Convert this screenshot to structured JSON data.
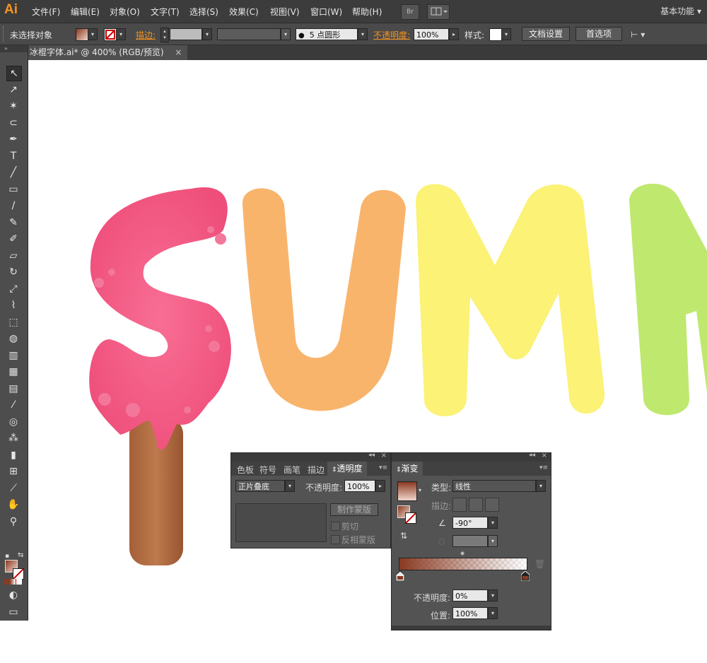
{
  "app": {
    "logo": "Ai",
    "workspace": "基本功能"
  },
  "menu": [
    "文件(F)",
    "编辑(E)",
    "对象(O)",
    "文字(T)",
    "选择(S)",
    "效果(C)",
    "视图(V)",
    "窗口(W)",
    "帮助(H)"
  ],
  "menubar_buttons": {
    "bridge": "Br"
  },
  "control": {
    "no_selection": "未选择对象",
    "stroke_label": "描边:",
    "brush": "5 点圆形",
    "opacity_label": "不透明度:",
    "opacity_value": "100%",
    "style_label": "样式:",
    "doc_setup": "文档设置",
    "preferences": "首选项"
  },
  "document": {
    "tab_title": "冰棍字体.ai* @ 400% (RGB/预览)",
    "close": "×"
  },
  "toolbar": {
    "tools": [
      {
        "name": "selection-tool",
        "glyph": "↖"
      },
      {
        "name": "direct-selection-tool",
        "glyph": "↗"
      },
      {
        "name": "magic-wand-tool",
        "glyph": "✶"
      },
      {
        "name": "lasso-tool",
        "glyph": "⊂"
      },
      {
        "name": "pen-tool",
        "glyph": "✒"
      },
      {
        "name": "type-tool",
        "glyph": "T"
      },
      {
        "name": "line-tool",
        "glyph": "╱"
      },
      {
        "name": "rectangle-tool",
        "glyph": "▭"
      },
      {
        "name": "paintbrush-tool",
        "glyph": "∕"
      },
      {
        "name": "pencil-tool",
        "glyph": "✎"
      },
      {
        "name": "blob-brush-tool",
        "glyph": "✐"
      },
      {
        "name": "eraser-tool",
        "glyph": "▱"
      },
      {
        "name": "rotate-tool",
        "glyph": "↻"
      },
      {
        "name": "scale-tool",
        "glyph": "⤢"
      },
      {
        "name": "warp-tool",
        "glyph": "⌇"
      },
      {
        "name": "free-transform-tool",
        "glyph": "⬚"
      },
      {
        "name": "shape-builder-tool",
        "glyph": "◍"
      },
      {
        "name": "perspective-grid-tool",
        "glyph": "▥"
      },
      {
        "name": "mesh-tool",
        "glyph": "▦"
      },
      {
        "name": "gradient-tool",
        "glyph": "▤"
      },
      {
        "name": "eyedropper-tool",
        "glyph": "⁄"
      },
      {
        "name": "blend-tool",
        "glyph": "◎"
      },
      {
        "name": "symbol-sprayer-tool",
        "glyph": "⁂"
      },
      {
        "name": "column-graph-tool",
        "glyph": "▮"
      },
      {
        "name": "artboard-tool",
        "glyph": "⊞"
      },
      {
        "name": "slice-tool",
        "glyph": "⟋"
      },
      {
        "name": "hand-tool",
        "glyph": "✋"
      },
      {
        "name": "zoom-tool",
        "glyph": "⚲"
      }
    ]
  },
  "artwork": {
    "letters": [
      "S",
      "U",
      "M",
      "M"
    ],
    "colors": [
      "#f25a84",
      "#f9b46c",
      "#fbf276",
      "#bfe86f"
    ]
  },
  "transparency_panel": {
    "tabs": [
      "色板",
      "符号",
      "画笔",
      "描边",
      "透明度"
    ],
    "blend_mode": "正片叠底",
    "opacity_label": "不透明度:",
    "opacity_value": "100%",
    "make_mask": "制作蒙版",
    "clip": "剪切",
    "invert_mask": "反相蒙版"
  },
  "gradient_panel": {
    "tab": "渐变",
    "type_label": "类型:",
    "type_value": "线性",
    "stroke_label": "描边:",
    "angle_value": "-90°",
    "opacity_label": "不透明度:",
    "opacity_value": "0%",
    "position_label": "位置:",
    "position_value": "100%",
    "start_color": "#8a3a22"
  }
}
